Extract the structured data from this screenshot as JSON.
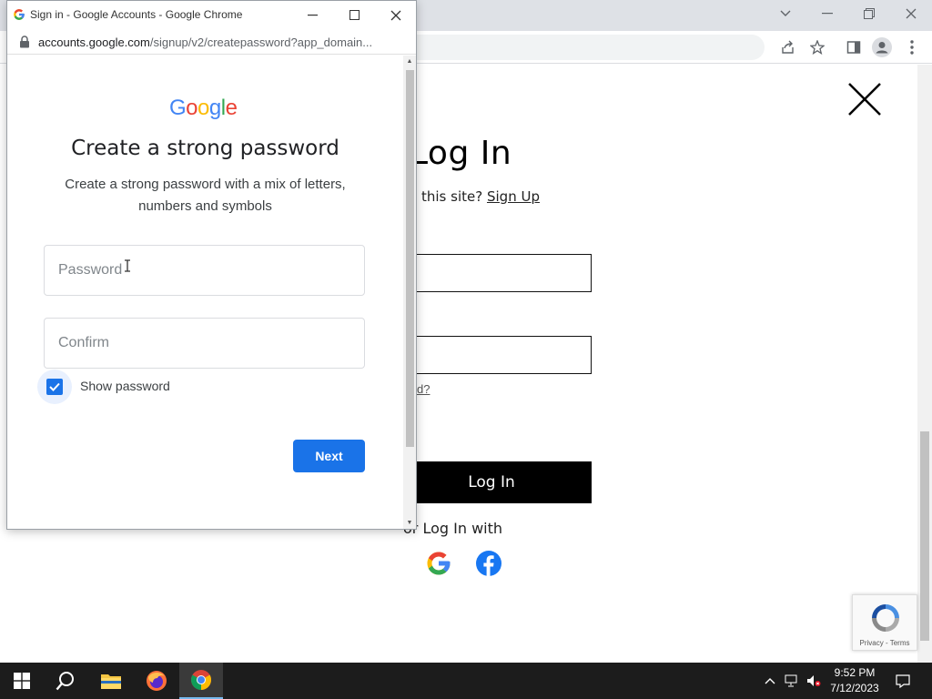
{
  "popup": {
    "window_title": "Sign in - Google Accounts - Google Chrome",
    "url_host": "accounts.google.com",
    "url_rest": "/signup/v2/createpassword?app_domain...",
    "logo_text": "Google",
    "heading": "Create a strong password",
    "subtext": "Create a strong password with a mix of letters, numbers and symbols",
    "password_placeholder": "Password",
    "confirm_placeholder": "Confirm",
    "show_password_label": "Show password",
    "show_password_checked": true,
    "next_label": "Next"
  },
  "site": {
    "title": "Log In",
    "signup_prompt": "this site?",
    "signup_link": "Sign Up",
    "forgot_fragment": "d?",
    "login_button": "Log In",
    "or_login_with": "or Log In with"
  },
  "recaptcha": {
    "links": "Privacy - Terms"
  },
  "taskbar": {
    "time": "9:52 PM",
    "date": "7/12/2023"
  },
  "colors": {
    "google_blue": "#1a73e8",
    "site_button": "#000000",
    "taskbar": "#1c1c1c"
  }
}
